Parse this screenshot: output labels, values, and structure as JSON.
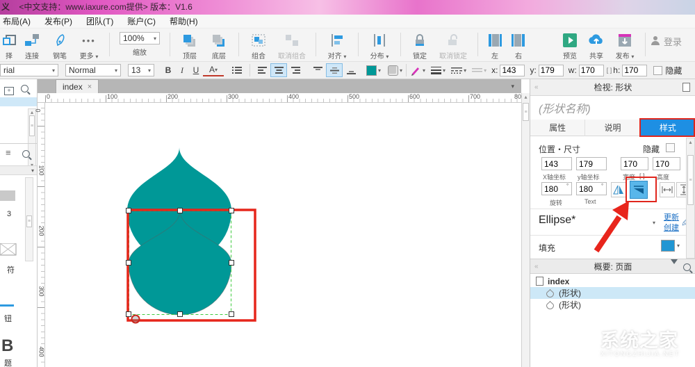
{
  "title_bar": {
    "icon_text": "义",
    "text": "<中文支持：www.iaxure.com提供> 版本：V1.6"
  },
  "menu": {
    "items": [
      "布局(A)",
      "发布(P)",
      "团队(T)",
      "账户(C)",
      "帮助(H)"
    ]
  },
  "toolbar": {
    "select_partial": "择",
    "connect": "连接",
    "pen": "钢笔",
    "more": "更多",
    "zoom_value": "100%",
    "zoom_label": "缩放",
    "front": "顶层",
    "back": "底层",
    "group": "组合",
    "ungroup": "取消组合",
    "align": "对齐",
    "distribute": "分布",
    "lock": "锁定",
    "unlock": "取消锁定",
    "left": "左",
    "right": "右",
    "preview": "预览",
    "share": "共享",
    "publish": "发布",
    "login": "登录"
  },
  "format": {
    "font": "rial",
    "font_style": "Normal",
    "font_size": "13",
    "bold": "B",
    "italic": "I",
    "underline": "U",
    "color_btn": "A",
    "x_label": "x:",
    "x": "143",
    "y_label": "y:",
    "y": "179",
    "w_label": "w:",
    "w": "170",
    "link_glyph": "[ ]",
    "h_label": "h:",
    "h": "170",
    "hide": "隐藏"
  },
  "tabs": {
    "active": "index",
    "close_glyph": "×"
  },
  "rulers": {
    "h": [
      "0",
      "100",
      "200",
      "300",
      "400",
      "500",
      "600",
      "700",
      "80"
    ],
    "v": [
      "0",
      "100",
      "200",
      "300",
      "400"
    ]
  },
  "sidebar": {
    "widget_labels": [
      "3",
      "符",
      "钮",
      "题"
    ],
    "heading_letter": "B"
  },
  "canvas": {
    "shape_fill": "#009897"
  },
  "inspector": {
    "header": "检视: 形状",
    "name_placeholder": "(形状名称)",
    "tab_props": "属性",
    "tab_notes": "说明",
    "tab_style": "样式",
    "section_pos_size": "位置・尺寸",
    "hide": "隐藏",
    "x": "143",
    "y": "179",
    "w": "170",
    "h": "170",
    "x_label": "X轴坐标",
    "y_label": "y轴坐标",
    "w_label": "宽度",
    "h_label": "高度",
    "link_glyph": "[ ]",
    "rotate": "180",
    "rotate_label": "旋转",
    "text_rotate": "180",
    "text_rotate_label": "Text",
    "degree": "°",
    "style_name": "Ellipse*",
    "update": "更新",
    "create": "创建",
    "fill_label": "填充",
    "fill_color": "#2196d3"
  },
  "outline": {
    "header": "概要: 页面",
    "page": "index",
    "shape1": "(形状)",
    "shape2": "(形状)"
  },
  "watermark": {
    "title": "系统之家",
    "subtitle": "XITONGZHIJIA.NET"
  }
}
